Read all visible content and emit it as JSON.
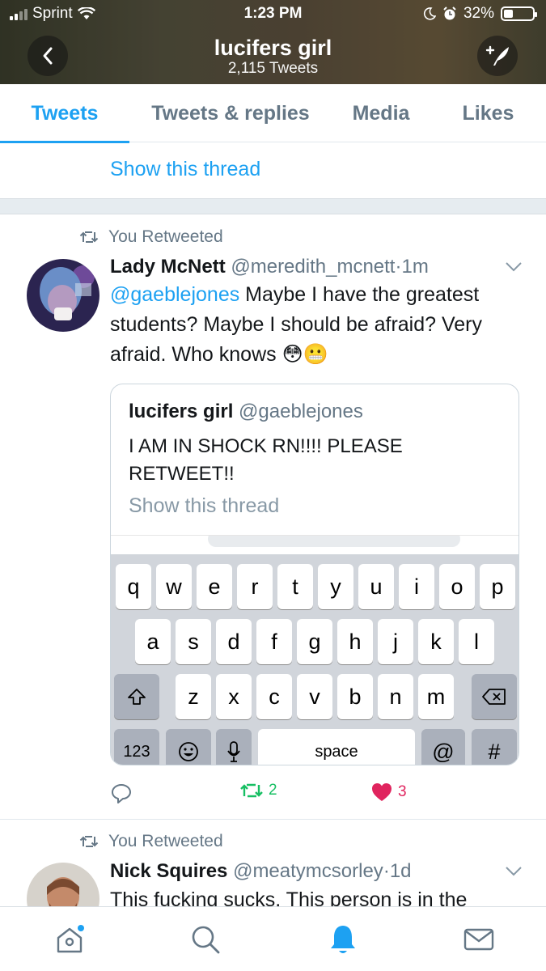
{
  "status_bar": {
    "carrier": "Sprint",
    "time": "1:23 PM",
    "battery": "32%",
    "battery_level": 0.32
  },
  "header": {
    "title": "lucifers girl",
    "subtitle": "2,115 Tweets",
    "back_icon": "chevron-left-icon",
    "compose_icon": "compose-feather-icon"
  },
  "tabs": [
    {
      "label": "Tweets",
      "active": true
    },
    {
      "label": "Tweets & replies",
      "active": false
    },
    {
      "label": "Media",
      "active": false
    },
    {
      "label": "Likes",
      "active": false
    }
  ],
  "top_thread_link": "Show this thread",
  "tweets": [
    {
      "retweet_label": "You Retweeted",
      "name": "Lady McNett",
      "handle": "@meredith_mcnett",
      "time": "1m",
      "mention": "@gaeblejones",
      "text": " Maybe I have the greatest students? Maybe I should be afraid? Very afraid. Who knows ",
      "emoji": "😳😬",
      "quote": {
        "name": "lucifers girl",
        "handle": "@gaeblejones",
        "text": "I AM IN SHOCK RN!!!! PLEASE RETWEET!!",
        "thread_link": "Show this thread",
        "keyboard": {
          "row1": [
            "q",
            "w",
            "e",
            "r",
            "t",
            "y",
            "u",
            "i",
            "o",
            "p"
          ],
          "row2": [
            "a",
            "s",
            "d",
            "f",
            "g",
            "h",
            "j",
            "k",
            "l"
          ],
          "row3": [
            "z",
            "x",
            "c",
            "v",
            "b",
            "n",
            "m"
          ],
          "numbers": "123",
          "space": "space",
          "at": "@",
          "hash": "#"
        }
      },
      "retweets": "2",
      "likes": "3"
    },
    {
      "retweet_label": "You Retweeted",
      "name": "Nick Squires",
      "handle": "@meatymcsorley",
      "time": "1d",
      "text": "This fucking sucks. This person is in the"
    }
  ],
  "colors": {
    "accent": "#1da1f2",
    "retweet": "#17bf63",
    "like": "#e0245e",
    "muted": "#657786"
  },
  "bottom_nav": [
    "home-icon",
    "search-icon",
    "notifications-bell-icon",
    "messages-envelope-icon"
  ]
}
